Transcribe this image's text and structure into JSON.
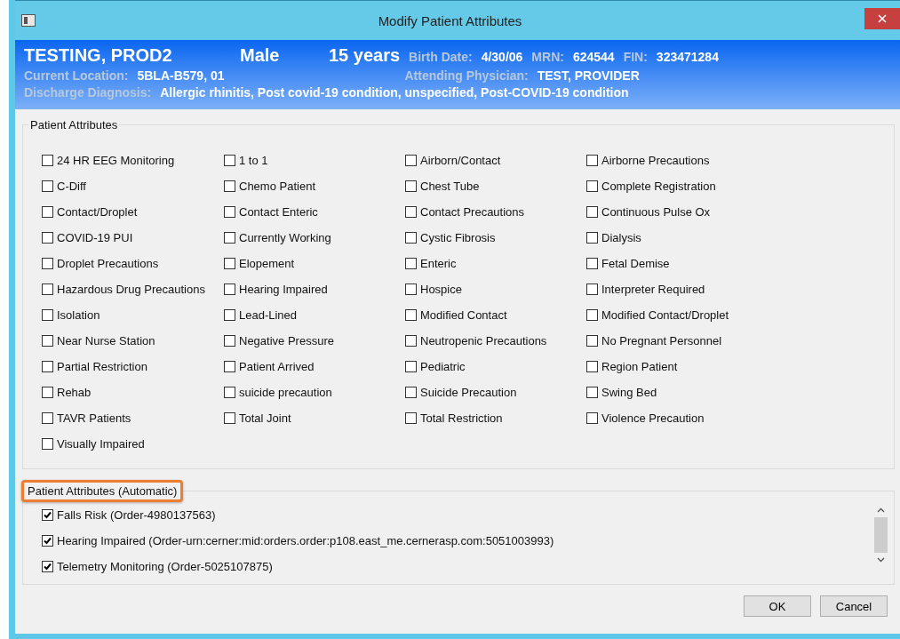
{
  "window": {
    "title": "Modify Patient Attributes"
  },
  "header": {
    "name": "TESTING, PROD2",
    "sex": "Male",
    "age": "15 years",
    "fields": [
      {
        "label": "Birth Date:",
        "value": "4/30/06"
      },
      {
        "label": "MRN:",
        "value": "624544"
      },
      {
        "label": "FIN:",
        "value": "323471284"
      }
    ],
    "location": {
      "label": "Current Location:",
      "value": "5BLA-B579, 01"
    },
    "physician": {
      "label": "Attending Physician:",
      "value": "TEST, PROVIDER"
    },
    "diagnosis": {
      "label": "Discharge Diagnosis:",
      "value": "Allergic rhinitis, Post covid-19 condition, unspecified, Post-COVID-19 condition"
    }
  },
  "attributes": {
    "title": "Patient Attributes",
    "items": [
      {
        "label": "24 HR EEG Monitoring",
        "checked": false
      },
      {
        "label": "1 to 1",
        "checked": false
      },
      {
        "label": "Airborn/Contact",
        "checked": false
      },
      {
        "label": "Airborne Precautions",
        "checked": false
      },
      {
        "label": "C-Diff",
        "checked": false
      },
      {
        "label": "Chemo Patient",
        "checked": false
      },
      {
        "label": "Chest Tube",
        "checked": false
      },
      {
        "label": "Complete Registration",
        "checked": false
      },
      {
        "label": "Contact/Droplet",
        "checked": false
      },
      {
        "label": "Contact Enteric",
        "checked": false
      },
      {
        "label": "Contact Precautions",
        "checked": false
      },
      {
        "label": "Continuous Pulse Ox",
        "checked": false
      },
      {
        "label": "COVID-19 PUI",
        "checked": false
      },
      {
        "label": "Currently Working",
        "checked": false
      },
      {
        "label": "Cystic Fibrosis",
        "checked": false
      },
      {
        "label": "Dialysis",
        "checked": false
      },
      {
        "label": "Droplet Precautions",
        "checked": false
      },
      {
        "label": "Elopement",
        "checked": false
      },
      {
        "label": "Enteric",
        "checked": false
      },
      {
        "label": "Fetal Demise",
        "checked": false
      },
      {
        "label": "Hazardous Drug Precautions",
        "checked": false
      },
      {
        "label": "Hearing Impaired",
        "checked": false
      },
      {
        "label": "Hospice",
        "checked": false
      },
      {
        "label": "Interpreter Required",
        "checked": false
      },
      {
        "label": "Isolation",
        "checked": false
      },
      {
        "label": "Lead-Lined",
        "checked": false
      },
      {
        "label": "Modified Contact",
        "checked": false
      },
      {
        "label": "Modified Contact/Droplet",
        "checked": false
      },
      {
        "label": "Near Nurse Station",
        "checked": false
      },
      {
        "label": "Negative Pressure",
        "checked": false
      },
      {
        "label": "Neutropenic Precautions",
        "checked": false
      },
      {
        "label": "No Pregnant Personnel",
        "checked": false
      },
      {
        "label": "Partial Restriction",
        "checked": false
      },
      {
        "label": "Patient Arrived",
        "checked": false
      },
      {
        "label": "Pediatric",
        "checked": false
      },
      {
        "label": "Region Patient",
        "checked": false
      },
      {
        "label": "Rehab",
        "checked": false
      },
      {
        "label": "suicide precaution",
        "checked": false
      },
      {
        "label": "Suicide Precaution",
        "checked": false
      },
      {
        "label": "Swing Bed",
        "checked": false
      },
      {
        "label": "TAVR Patients",
        "checked": false
      },
      {
        "label": "Total Joint",
        "checked": false
      },
      {
        "label": "Total Restriction",
        "checked": false
      },
      {
        "label": "Violence Precaution",
        "checked": false
      },
      {
        "label": "Visually Impaired",
        "checked": false
      }
    ]
  },
  "automatic": {
    "title": "Patient Attributes (Automatic)",
    "items": [
      {
        "label": "Falls Risk (Order-4980137563)",
        "checked": true
      },
      {
        "label": "Hearing Impaired (Order-urn:cerner:mid:orders.order:p108.east_me.cernerasp.com:5051003993)",
        "checked": true
      },
      {
        "label": "Telemetry Monitoring (Order-5025107875)",
        "checked": true
      }
    ]
  },
  "buttons": [
    "OK",
    "Cancel"
  ]
}
